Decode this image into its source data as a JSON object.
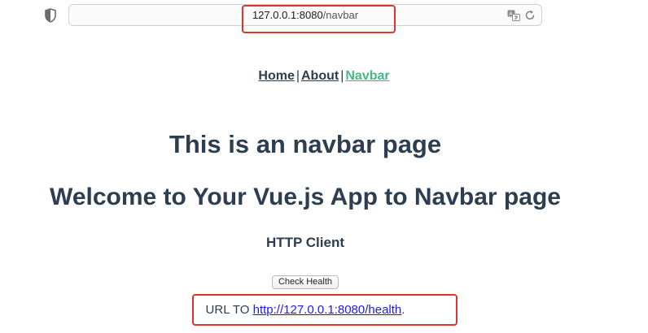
{
  "browser": {
    "address": {
      "host": "127.0.0.1:8080",
      "path": "/navbar"
    },
    "icons": {
      "shield": "shield-icon",
      "translate": "translate-icon",
      "reload": "reload-icon"
    }
  },
  "nav": {
    "items": [
      {
        "label": "Home"
      },
      {
        "label": "About"
      },
      {
        "label": "Navbar",
        "active": true
      }
    ],
    "separator": "|"
  },
  "main": {
    "title": "This is an navbar page",
    "welcome": "Welcome to Your Vue.js App to Navbar page",
    "section_title": "HTTP Client",
    "check_button_label": "Check Health",
    "url_prefix": "URL TO ",
    "health_link": "http://127.0.0.1:8080/health",
    "url_suffix": "."
  },
  "colors": {
    "text": "#2c3e50",
    "active_link": "#42b983",
    "link": "#1a1aee",
    "highlight_border": "#e0332d"
  }
}
